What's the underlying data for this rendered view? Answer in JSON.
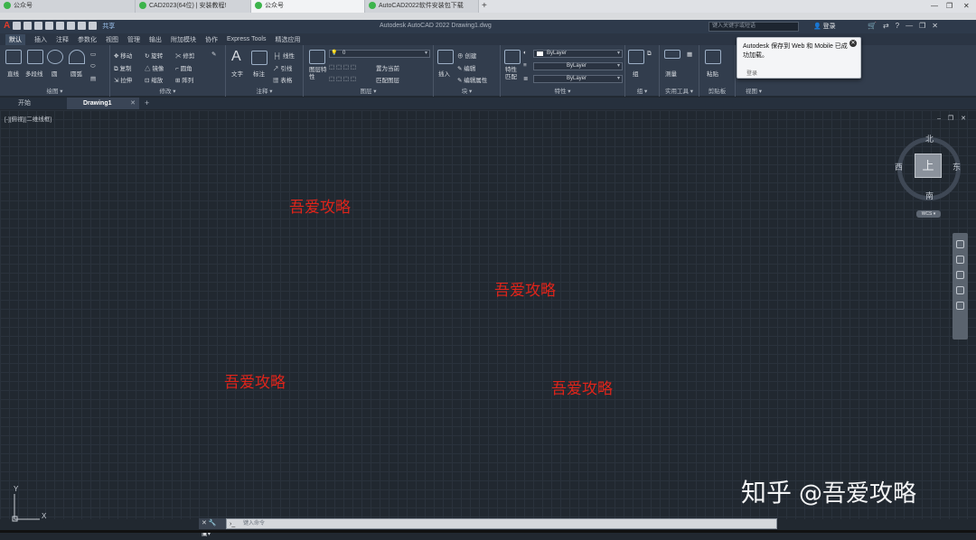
{
  "browser": {
    "tabs": [
      {
        "label": "公众号",
        "active": false
      },
      {
        "label": "CAD2023(64位) | 安装教程!",
        "active": false
      },
      {
        "label": "公众号",
        "active": true
      },
      {
        "label": "AutoCAD2022软件安装包下载",
        "active": false
      }
    ],
    "new_tab": "+",
    "window_controls": [
      "—",
      "❐",
      "✕"
    ]
  },
  "titlebar": {
    "share": "共享",
    "title": "Autodesk AutoCAD 2022    Drawing1.dwg",
    "search_placeholder": "键入关键字或短语",
    "login": "登录",
    "help": "?"
  },
  "menu": {
    "items": [
      "默认",
      "插入",
      "注释",
      "参数化",
      "视图",
      "管理",
      "输出",
      "附加模块",
      "协作",
      "Express Tools",
      "精选应用"
    ],
    "active_index": 0
  },
  "ribbon": {
    "draw": {
      "title": "绘图 ▾",
      "tools": [
        "直线",
        "多段线",
        "圆",
        "圆弧"
      ]
    },
    "modify": {
      "title": "修改 ▾",
      "tools": [
        "移动",
        "旋转",
        "修剪",
        "复制",
        "镜像",
        "圆角",
        "拉伸",
        "缩放",
        "阵列"
      ]
    },
    "annotation": {
      "title": "注释 ▾",
      "tools": [
        "文字",
        "标注",
        "线性",
        "引线",
        "表格"
      ]
    },
    "layers": {
      "title": "图层 ▾",
      "tools": [
        "图层特性",
        "置为当前",
        "匹配图层"
      ],
      "layer_value": "0"
    },
    "block": {
      "title": "块 ▾",
      "tools": [
        "插入",
        "创建",
        "编辑",
        "编辑属性"
      ]
    },
    "properties": {
      "title": "特性 ▾",
      "tools": [
        "特性匹配"
      ],
      "color": "ByLayer",
      "linetype": "ByLayer",
      "lineweight": "ByLayer"
    },
    "groups": {
      "title": "组 ▾",
      "tools": [
        "组"
      ]
    },
    "utilities": {
      "title": "实用工具 ▾",
      "tools": [
        "测量"
      ]
    },
    "clipboard": {
      "title": "剪贴板",
      "tools": [
        "粘贴"
      ]
    },
    "view": {
      "title": "视图 ▾"
    }
  },
  "popup": {
    "text": "Autodesk 保存到 Web 和 Mobile 已成功加载。",
    "login": "登录"
  },
  "file_tabs": [
    {
      "label": "开始",
      "active": false
    },
    {
      "label": "Drawing1",
      "active": true,
      "close": "✕"
    }
  ],
  "viewport": {
    "label": "[-][俯视][二维线框]",
    "controls": "– ❐ ✕"
  },
  "viewcube": {
    "top": "上",
    "north": "北",
    "south": "南",
    "east": "东",
    "west": "西",
    "wcs": "WCS ▾"
  },
  "watermarks": [
    "吾爱攻略",
    "吾爱攻略",
    "吾爱攻略",
    "吾爱攻略"
  ],
  "ucs": {
    "x": "X",
    "y": "Y"
  },
  "command_line": {
    "placeholder": "键入命令",
    "icons": "✕ 🔧 ▣▾"
  },
  "branding": {
    "site": "知乎",
    "account": "@吾爱攻略"
  },
  "colors": {
    "canvas": "#212830",
    "watermark": "#e0241a",
    "ribbon": "#323d4d"
  }
}
